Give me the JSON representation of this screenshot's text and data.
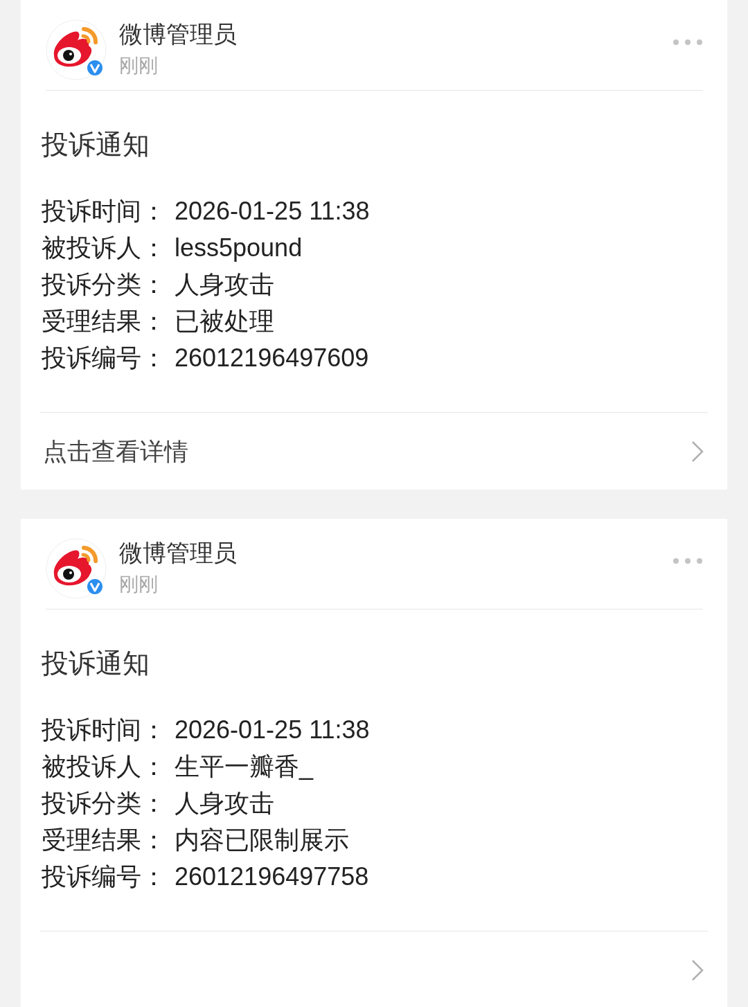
{
  "cards": [
    {
      "sender": {
        "name": "微博管理员",
        "time": "刚刚",
        "verified": true
      },
      "title": "投诉通知",
      "fields": [
        {
          "label": "投诉时间：",
          "value": "2026-01-25 11:38"
        },
        {
          "label": "被投诉人：",
          "value": "less5pound"
        },
        {
          "label": "投诉分类：",
          "value": "人身攻击"
        },
        {
          "label": "受理结果：",
          "value": "已被处理"
        },
        {
          "label": "投诉编号：",
          "value": "26012196497609"
        }
      ],
      "footer": {
        "text": "点击查看详情"
      }
    },
    {
      "sender": {
        "name": "微博管理员",
        "time": "刚刚",
        "verified": true
      },
      "title": "投诉通知",
      "fields": [
        {
          "label": "投诉时间：",
          "value": "2026-01-25 11:38"
        },
        {
          "label": "被投诉人：",
          "value": "生平一瓣香_"
        },
        {
          "label": "投诉分类：",
          "value": "人身攻击"
        },
        {
          "label": "受理结果：",
          "value": "内容已限制展示"
        },
        {
          "label": "投诉编号：",
          "value": "26012196497758"
        }
      ]
    }
  ]
}
